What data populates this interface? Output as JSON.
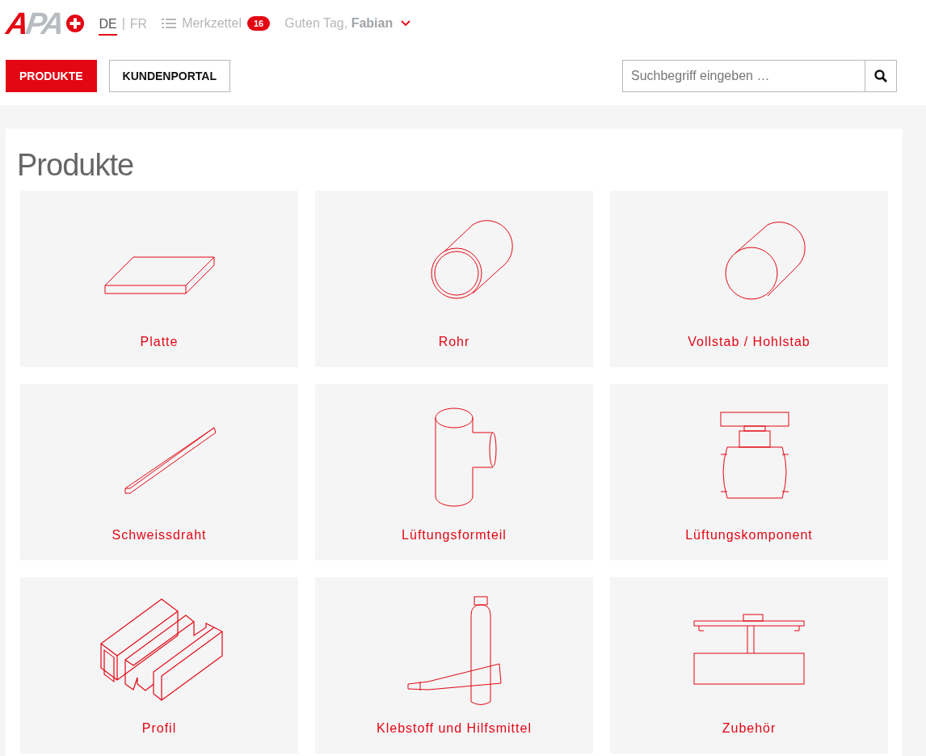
{
  "logo": {
    "text": "APA"
  },
  "languages": [
    {
      "label": "DE",
      "selected": true
    },
    {
      "label": "FR",
      "selected": false
    }
  ],
  "language_separator": "|",
  "watchlist": {
    "label": "Merkzettel",
    "count": "16"
  },
  "greeting": {
    "text": "Guten Tag,",
    "name": "Fabian"
  },
  "nav": [
    {
      "label": "PRODUKTE",
      "selected": true
    },
    {
      "label": "KUNDENPORTAL",
      "selected": false
    }
  ],
  "search": {
    "placeholder": "Suchbegriff eingeben …"
  },
  "page_title": "Produkte",
  "products": [
    {
      "label": "Platte",
      "kind": "plate"
    },
    {
      "label": "Rohr",
      "kind": "tube"
    },
    {
      "label": "Vollstab / Hohlstab",
      "kind": "rod"
    },
    {
      "label": "Schweissdraht",
      "kind": "wire"
    },
    {
      "label": "Lüftungsformteil",
      "kind": "tee"
    },
    {
      "label": "Lüftungskomponent",
      "kind": "component"
    },
    {
      "label": "Profil",
      "kind": "profile"
    },
    {
      "label": "Klebstoff und Hilfsmittel",
      "kind": "adhesive"
    },
    {
      "label": "Zubehör",
      "kind": "accessory"
    }
  ]
}
